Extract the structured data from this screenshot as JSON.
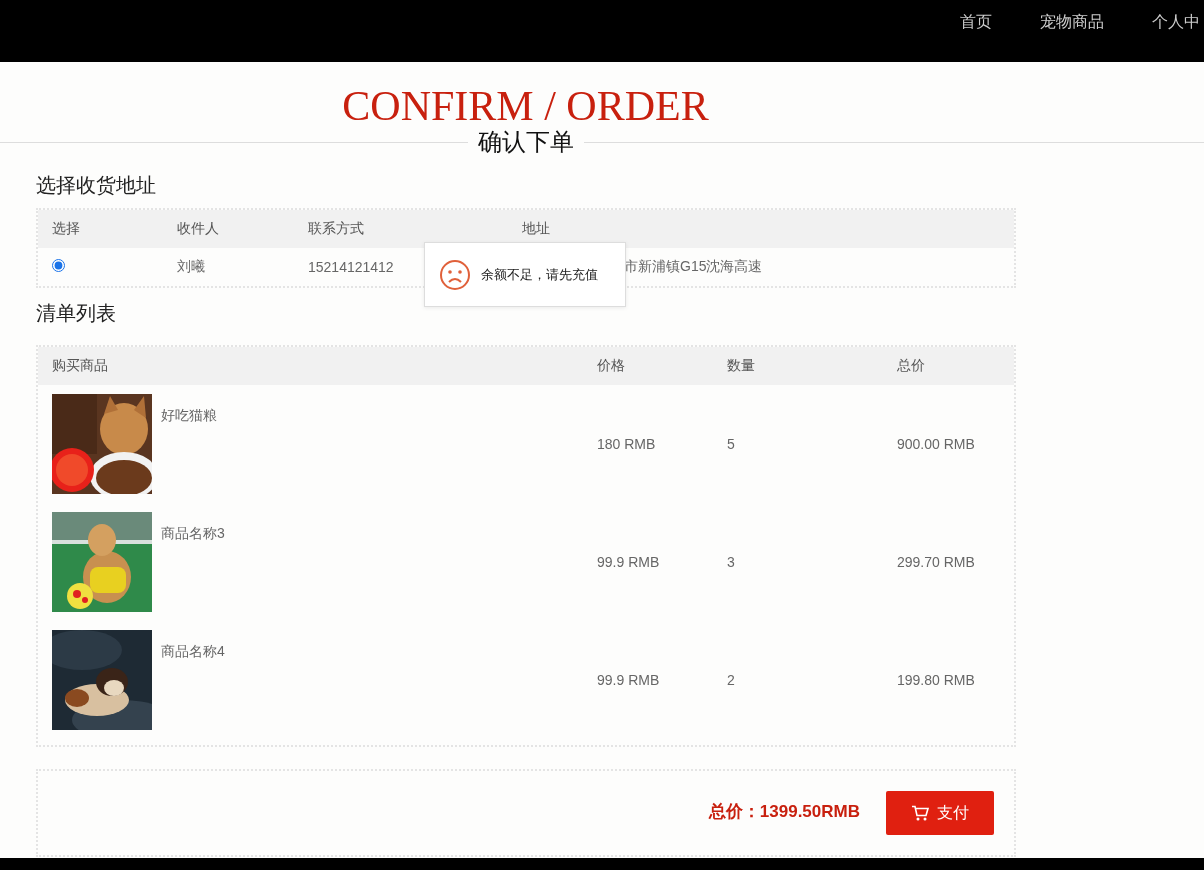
{
  "nav": {
    "items": [
      {
        "label": "首页",
        "selected": false
      },
      {
        "label": "宠物商品",
        "selected": false
      },
      {
        "label": "个人中",
        "selected": false
      }
    ]
  },
  "title": {
    "english": "CONFIRM / ORDER",
    "chinese": "确认下单"
  },
  "address": {
    "heading": "选择收货地址",
    "columns": [
      "选择",
      "收件人",
      "联系方式",
      "地址"
    ],
    "rows": [
      {
        "selected": true,
        "recipient": "刘曦",
        "phone": "15214121412",
        "address": "市新浦镇G15沈海高速"
      }
    ]
  },
  "toast": {
    "message": "余额不足，请先充值"
  },
  "order": {
    "heading": "清单列表",
    "columns": [
      "购买商品",
      "价格",
      "数量",
      "总价"
    ],
    "rows": [
      {
        "name": "好吃猫粮",
        "price": "180 RMB",
        "quantity": "5",
        "total": "900.00 RMB"
      },
      {
        "name": "商品名称3",
        "price": "99.9 RMB",
        "quantity": "3",
        "total": "299.70 RMB"
      },
      {
        "name": "商品名称4",
        "price": "99.9 RMB",
        "quantity": "2",
        "total": "199.80 RMB"
      }
    ]
  },
  "summary": {
    "total": "总价：1399.50RMB",
    "pay_button": "支付"
  }
}
